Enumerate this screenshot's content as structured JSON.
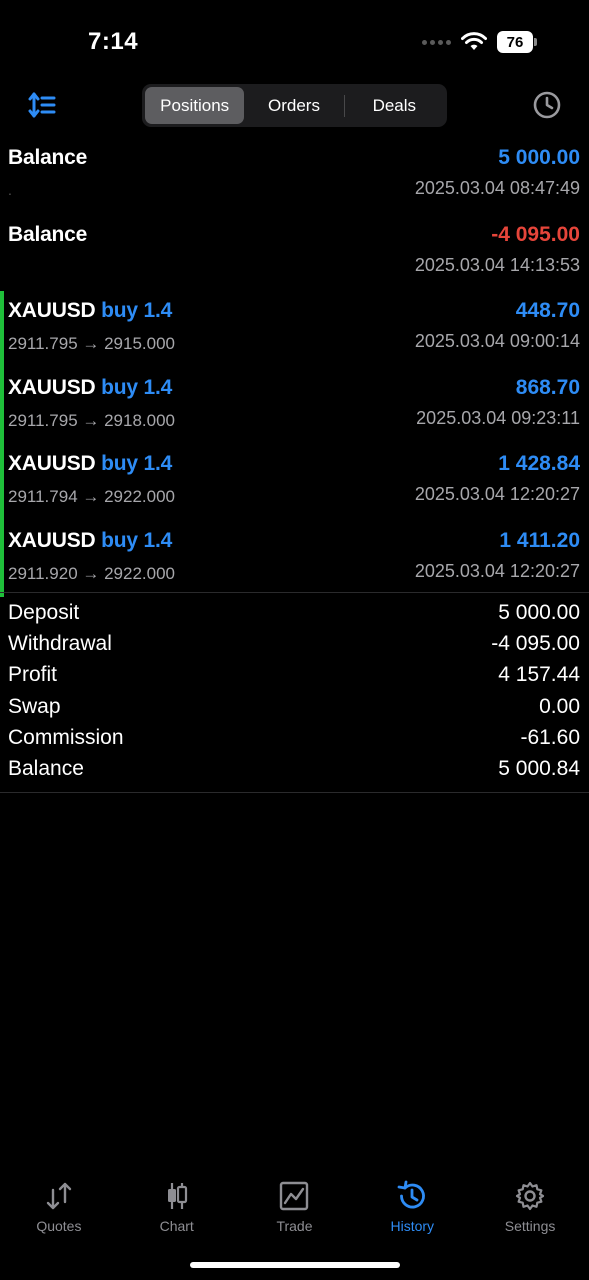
{
  "status": {
    "time": "7:14",
    "battery": "76"
  },
  "toolbar": {
    "segments": [
      "Positions",
      "Orders",
      "Deals"
    ],
    "active_segment": "Positions"
  },
  "rows": [
    {
      "kind": "balance",
      "title": "Balance",
      "amount": "5 000.00",
      "negative": false,
      "detail": "",
      "time": "2025.03.04 08:47:49"
    },
    {
      "kind": "balance",
      "title": "Balance",
      "amount": "-4 095.00",
      "negative": true,
      "detail": "",
      "time": "2025.03.04 14:13:53"
    },
    {
      "kind": "trade",
      "symbol": "XAUUSD",
      "direction": "buy 1.4",
      "amount": "448.70",
      "prices": "2911.795 → 2915.000",
      "time": "2025.03.04 09:00:14"
    },
    {
      "kind": "trade",
      "symbol": "XAUUSD",
      "direction": "buy 1.4",
      "amount": "868.70",
      "prices": "2911.795 → 2918.000",
      "time": "2025.03.04 09:23:11"
    },
    {
      "kind": "trade",
      "symbol": "XAUUSD",
      "direction": "buy 1.4",
      "amount": "1 428.84",
      "prices": "2911.794 → 2922.000",
      "time": "2025.03.04 12:20:27"
    },
    {
      "kind": "trade",
      "symbol": "XAUUSD",
      "direction": "buy 1.4",
      "amount": "1 411.20",
      "prices": "2911.920 → 2922.000",
      "time": "2025.03.04 12:20:27"
    }
  ],
  "summary": [
    {
      "label": "Deposit",
      "value": "5 000.00"
    },
    {
      "label": "Withdrawal",
      "value": "-4 095.00"
    },
    {
      "label": "Profit",
      "value": "4 157.44"
    },
    {
      "label": "Swap",
      "value": "0.00"
    },
    {
      "label": "Commission",
      "value": "-61.60"
    },
    {
      "label": "Balance",
      "value": "5 000.84"
    }
  ],
  "tabs": [
    {
      "label": "Quotes",
      "icon": "quotes-arrows-icon",
      "active": false
    },
    {
      "label": "Chart",
      "icon": "candlestick-icon",
      "active": false
    },
    {
      "label": "Trade",
      "icon": "trade-chart-icon",
      "active": false
    },
    {
      "label": "History",
      "icon": "history-clock-icon",
      "active": true
    },
    {
      "label": "Settings",
      "icon": "gear-icon",
      "active": false
    }
  ],
  "colors": {
    "accent": "#2e8cf5",
    "negative": "#e6453a",
    "trade_marker": "#1fbf3a",
    "muted": "#a7a7ab"
  }
}
